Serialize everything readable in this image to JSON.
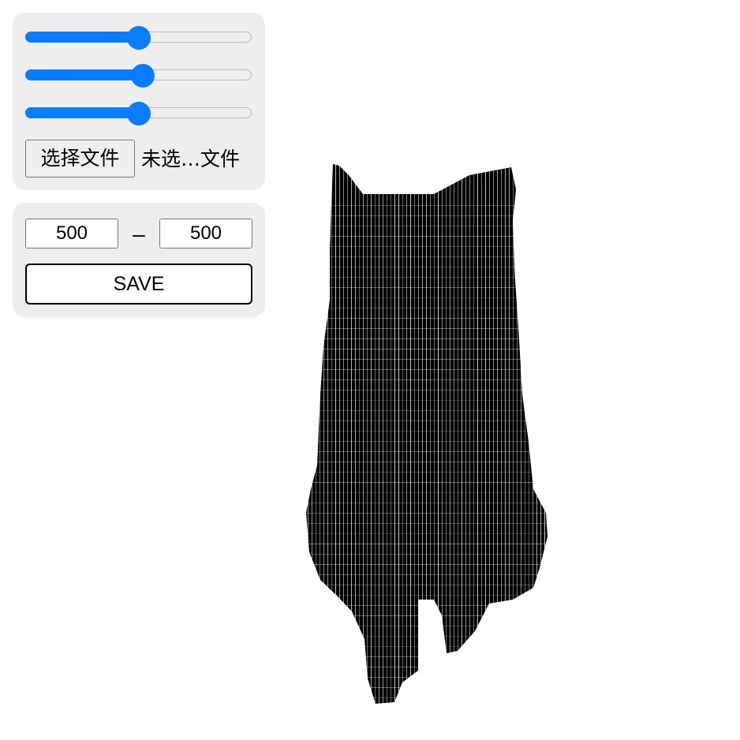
{
  "controls": {
    "sliders": [
      {
        "label": "slider-1",
        "value": 0.5
      },
      {
        "label": "slider-2",
        "value": 0.52
      },
      {
        "label": "slider-3",
        "value": 0.5
      }
    ],
    "file_button_label": "选择文件",
    "file_status": "未选…文件",
    "accent_color": "#0a7cff"
  },
  "size": {
    "width_value": "500",
    "separator": "–",
    "height_value": "500",
    "save_label": "SAVE"
  },
  "artwork": {
    "subject": "cat-silhouette",
    "fill_color": "#000000"
  }
}
